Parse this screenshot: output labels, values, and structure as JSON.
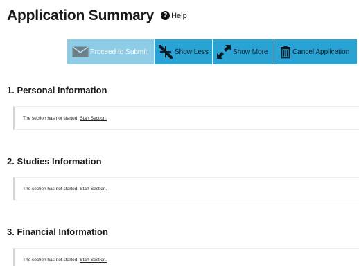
{
  "header": {
    "title": "Application Summary",
    "help_icon": "question-circle-icon",
    "help_label": "Help"
  },
  "toolbar": {
    "proceed_label": "Proceed to Submit",
    "proceed_icon": "envelope-icon",
    "show_less_label": "Show Less",
    "show_less_icon": "collapse-arrows-icon",
    "show_more_label": "Show More",
    "show_more_icon": "expand-arrows-icon",
    "cancel_label": "Cancel Application",
    "cancel_icon": "trash-icon"
  },
  "colors": {
    "button_bg": "#29a3d3",
    "button_disabled_bg": "#8fcde6"
  },
  "sections": [
    {
      "heading": "1. Personal Information",
      "status_text": "The section has not started.",
      "action_label": "Start Section."
    },
    {
      "heading": "2. Studies Information",
      "status_text": "The section has not started.",
      "action_label": "Start Section."
    },
    {
      "heading": "3. Financial Information",
      "status_text": "The section has not started.",
      "action_label": "Start Section."
    }
  ]
}
